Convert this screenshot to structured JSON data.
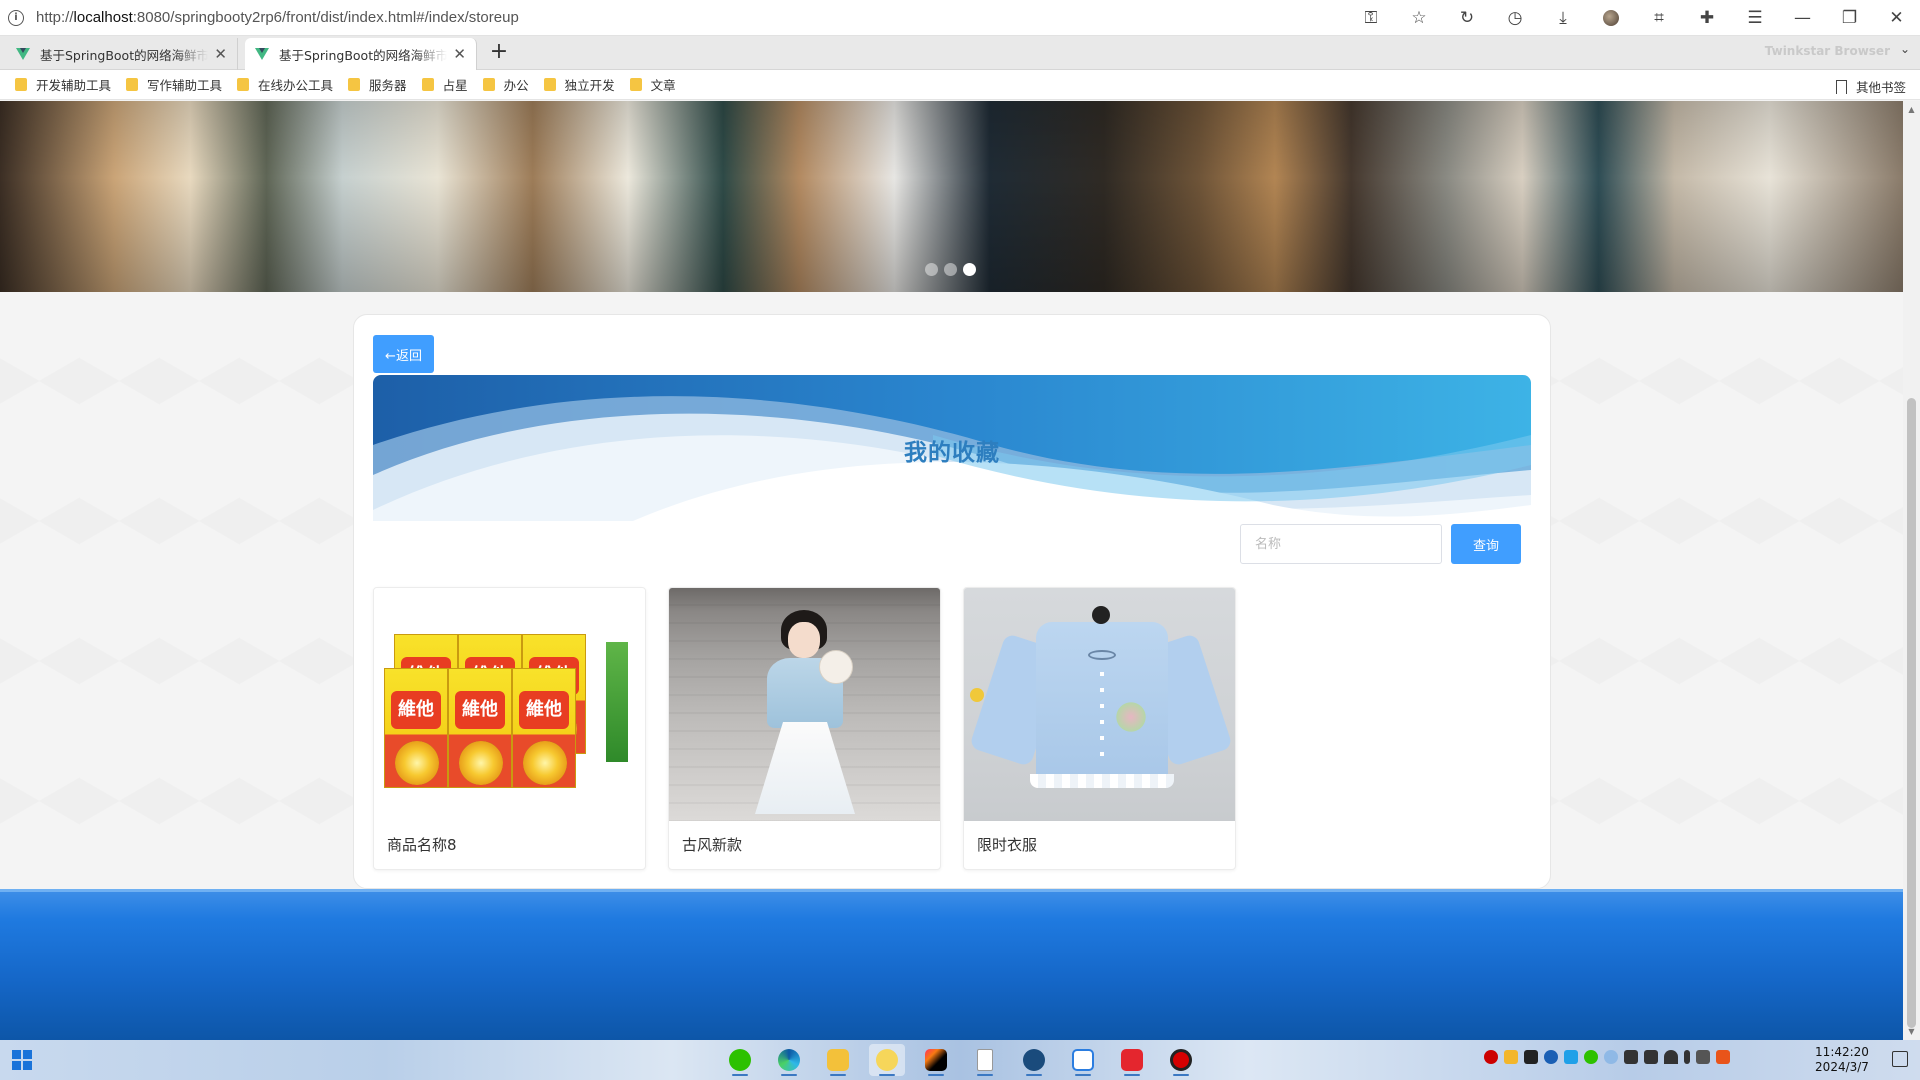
{
  "browser": {
    "url_prefix": "http://",
    "url_host": "localhost",
    "url_rest": ":8080/springbooty2rp6/front/dist/index.html#/index/storeup",
    "brand": "Twinkstar Browser",
    "tabs": [
      {
        "title": "基于SpringBoot的网络海鲜市场系统",
        "active": false
      },
      {
        "title": "基于SpringBoot的网络海鲜市场系统",
        "active": true
      }
    ],
    "new_tab": "+",
    "bookmarks": [
      "开发辅助工具",
      "写作辅助工具",
      "在线办公工具",
      "服务器",
      "占星",
      "办公",
      "独立开发",
      "文章"
    ],
    "other_bookmarks": "其他书签"
  },
  "banner": {
    "dots_count": 3,
    "active_dot": 2
  },
  "page": {
    "back_label": "←返回",
    "title": "我的收藏",
    "search": {
      "placeholder": "名称",
      "value": "",
      "button_label": "查询"
    },
    "products": [
      {
        "name": "商品名称8",
        "image": "juice-boxes"
      },
      {
        "name": "古风新款",
        "image": "hanfu-girl"
      },
      {
        "name": "限时衣服",
        "image": "blue-shirt"
      }
    ]
  },
  "taskbar": {
    "time": "11:42:20",
    "date": "2024/3/7",
    "apps": [
      "wechat-icon",
      "edge-icon",
      "folder-icon",
      "face-icon",
      "intellij-icon",
      "file-icon",
      "vs-icon",
      "teamviewer-icon",
      "wps-icon",
      "record-icon"
    ]
  },
  "colors": {
    "primary_button": "#409eff",
    "title_text": "#2d7ebf",
    "footer": "#1567c8"
  }
}
